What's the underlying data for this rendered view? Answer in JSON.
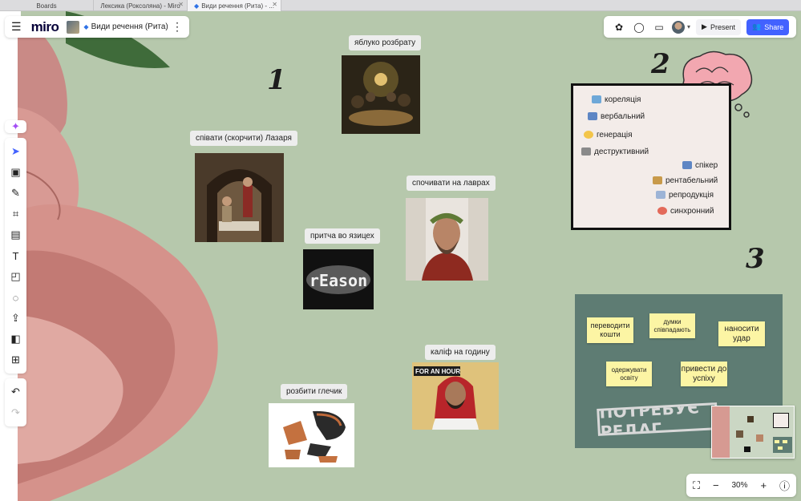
{
  "browser": {
    "tabs": [
      {
        "label": "Boards"
      },
      {
        "label": "Лексика (Роксоляна) - Miro"
      },
      {
        "label": "Види речення (Рита) - ..."
      }
    ]
  },
  "header": {
    "logo": "miro",
    "board_name": "Види речення (Рита)"
  },
  "toolbar_right": {
    "present_label": "Present",
    "share_label": "Share"
  },
  "canvas": {
    "numbers": [
      "1",
      "2",
      "3"
    ],
    "image_labels": {
      "apple": "яблуко розбрату",
      "lazarus": "співати (скорчити) Лазаря",
      "laurels": "спочивати на лаврах",
      "parable": "притча во язицех",
      "caliph": "каліф на годину",
      "jug": "розбити глечик"
    },
    "image_texts": {
      "reason": "rEason",
      "hour": "FOR AN HOUR"
    },
    "vocab_words": [
      "кореляція",
      "вербальний",
      "генерація",
      "деструктивний",
      "спікер",
      "рентабельний",
      "репродукція",
      "синхронний"
    ],
    "stickies": [
      "переводити кошти",
      "думки співпадають",
      "наносити удар",
      "одержувати освіту",
      "привести до успіху"
    ],
    "stamp": "ПОТРЕБУЄ РЕДАГ"
  },
  "zoom": {
    "value": "30%"
  },
  "colors": {
    "canvas": "#b6c8ac",
    "accent": "#4262ff",
    "sticky": "#fcf5a4",
    "green_board": "#5e7c73"
  }
}
